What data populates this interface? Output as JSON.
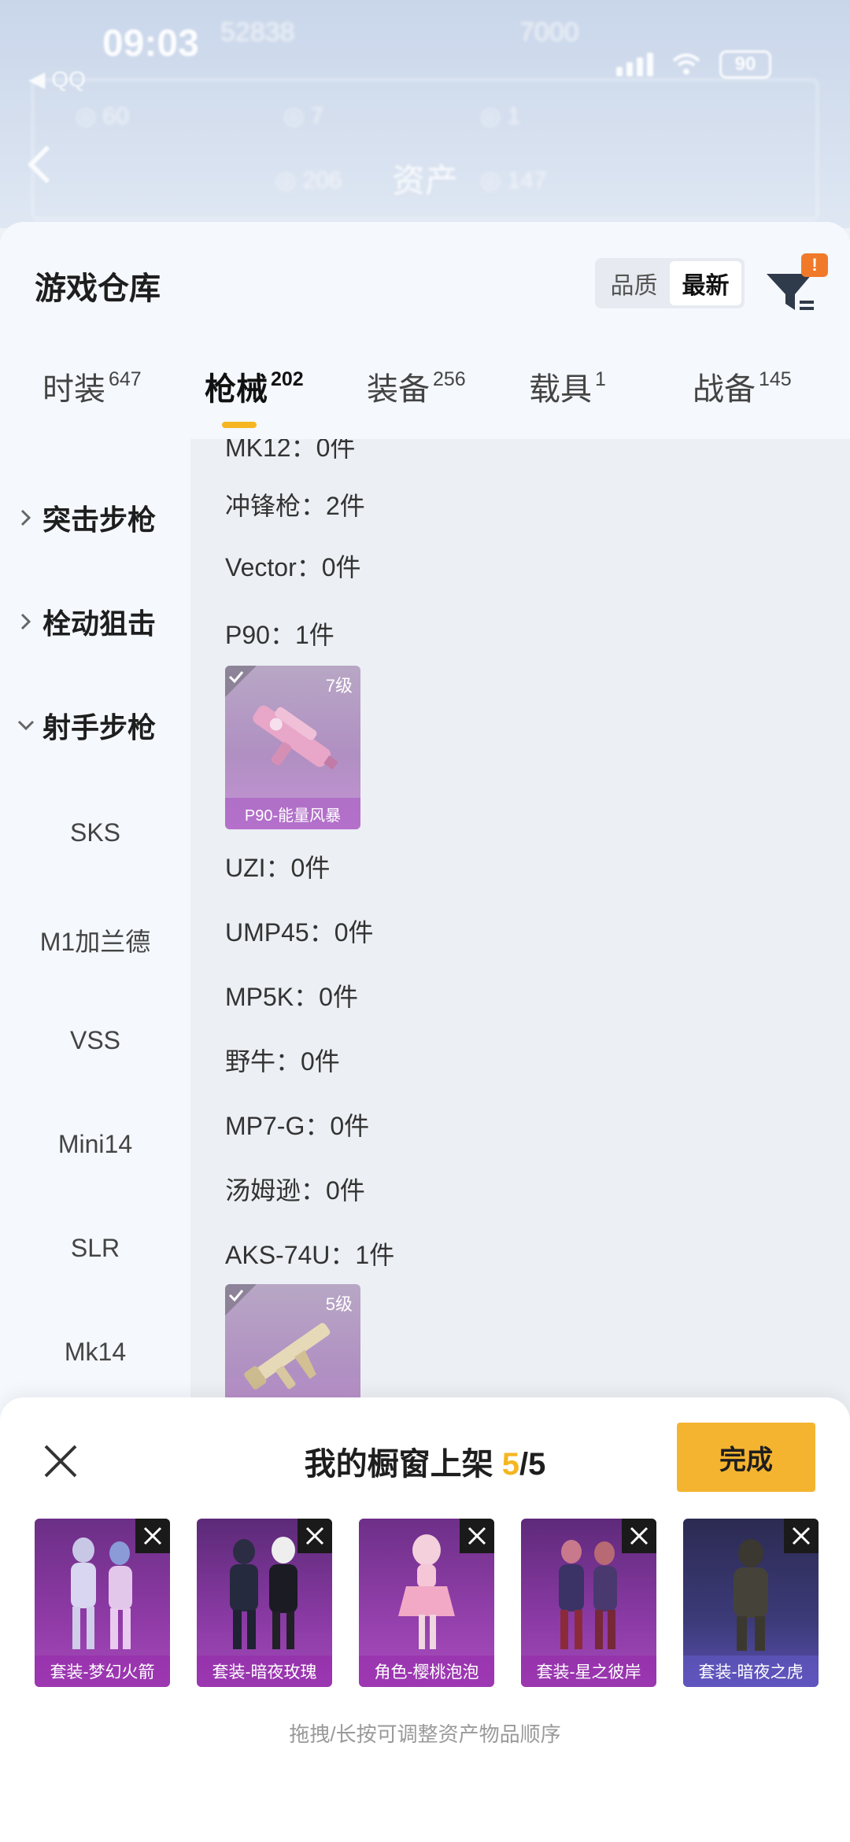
{
  "status_bar": {
    "time": "09:03",
    "back_app": "◀ QQ",
    "battery": "90"
  },
  "background_header": {
    "title": "资产",
    "stats": [
      "52838",
      "7000"
    ]
  },
  "sheet": {
    "title": "游戏仓库",
    "sort": {
      "options": [
        "品质",
        "最新"
      ],
      "active": "最新"
    },
    "filter_badge": "!"
  },
  "tabs": [
    {
      "label": "时装",
      "count": "647"
    },
    {
      "label": "枪械",
      "count": "202",
      "active": true
    },
    {
      "label": "装备",
      "count": "256"
    },
    {
      "label": "载具",
      "count": "1"
    },
    {
      "label": "战备",
      "count": "145"
    }
  ],
  "sidebar": {
    "categories": [
      {
        "label": "突击步枪",
        "expanded": false
      },
      {
        "label": "栓动狙击",
        "expanded": false
      },
      {
        "label": "射手步枪",
        "expanded": true
      }
    ],
    "subitems": [
      "SKS",
      "M1加兰德",
      "VSS",
      "Mini14",
      "SLR",
      "Mk14"
    ]
  },
  "content": {
    "partial_row": "MK12：0件",
    "rows": [
      {
        "text": "冲锋枪：2件"
      },
      {
        "text": "Vector：0件"
      },
      {
        "text": "P90：1件"
      },
      {
        "text": "UZI：0件"
      },
      {
        "text": "UMP45：0件"
      },
      {
        "text": "MP5K：0件"
      },
      {
        "text": "野牛：0件"
      },
      {
        "text": "MP7-G：0件"
      },
      {
        "text": "汤姆逊：0件"
      },
      {
        "text": "AKS-74U：1件"
      }
    ],
    "cards": [
      {
        "level": "7级",
        "name": "P90-能量风暴"
      },
      {
        "level": "5级",
        "name": ""
      }
    ]
  },
  "panel": {
    "title_prefix": "我的橱窗上架",
    "count_current": "5",
    "count_total": "/5",
    "done_label": "完成",
    "items": [
      {
        "caption": "套装-梦幻火箭"
      },
      {
        "caption": "套装-暗夜玫瑰"
      },
      {
        "caption": "角色-樱桃泡泡"
      },
      {
        "caption": "套装-星之彼岸"
      },
      {
        "caption": "套装-暗夜之虎"
      }
    ],
    "hint": "拖拽/长按可调整资产物品顺序"
  },
  "colors": {
    "accent": "#f5b622",
    "done_button": "#f5b430",
    "badge": "#f07a2a",
    "item_purple": "#9b3ab8"
  }
}
